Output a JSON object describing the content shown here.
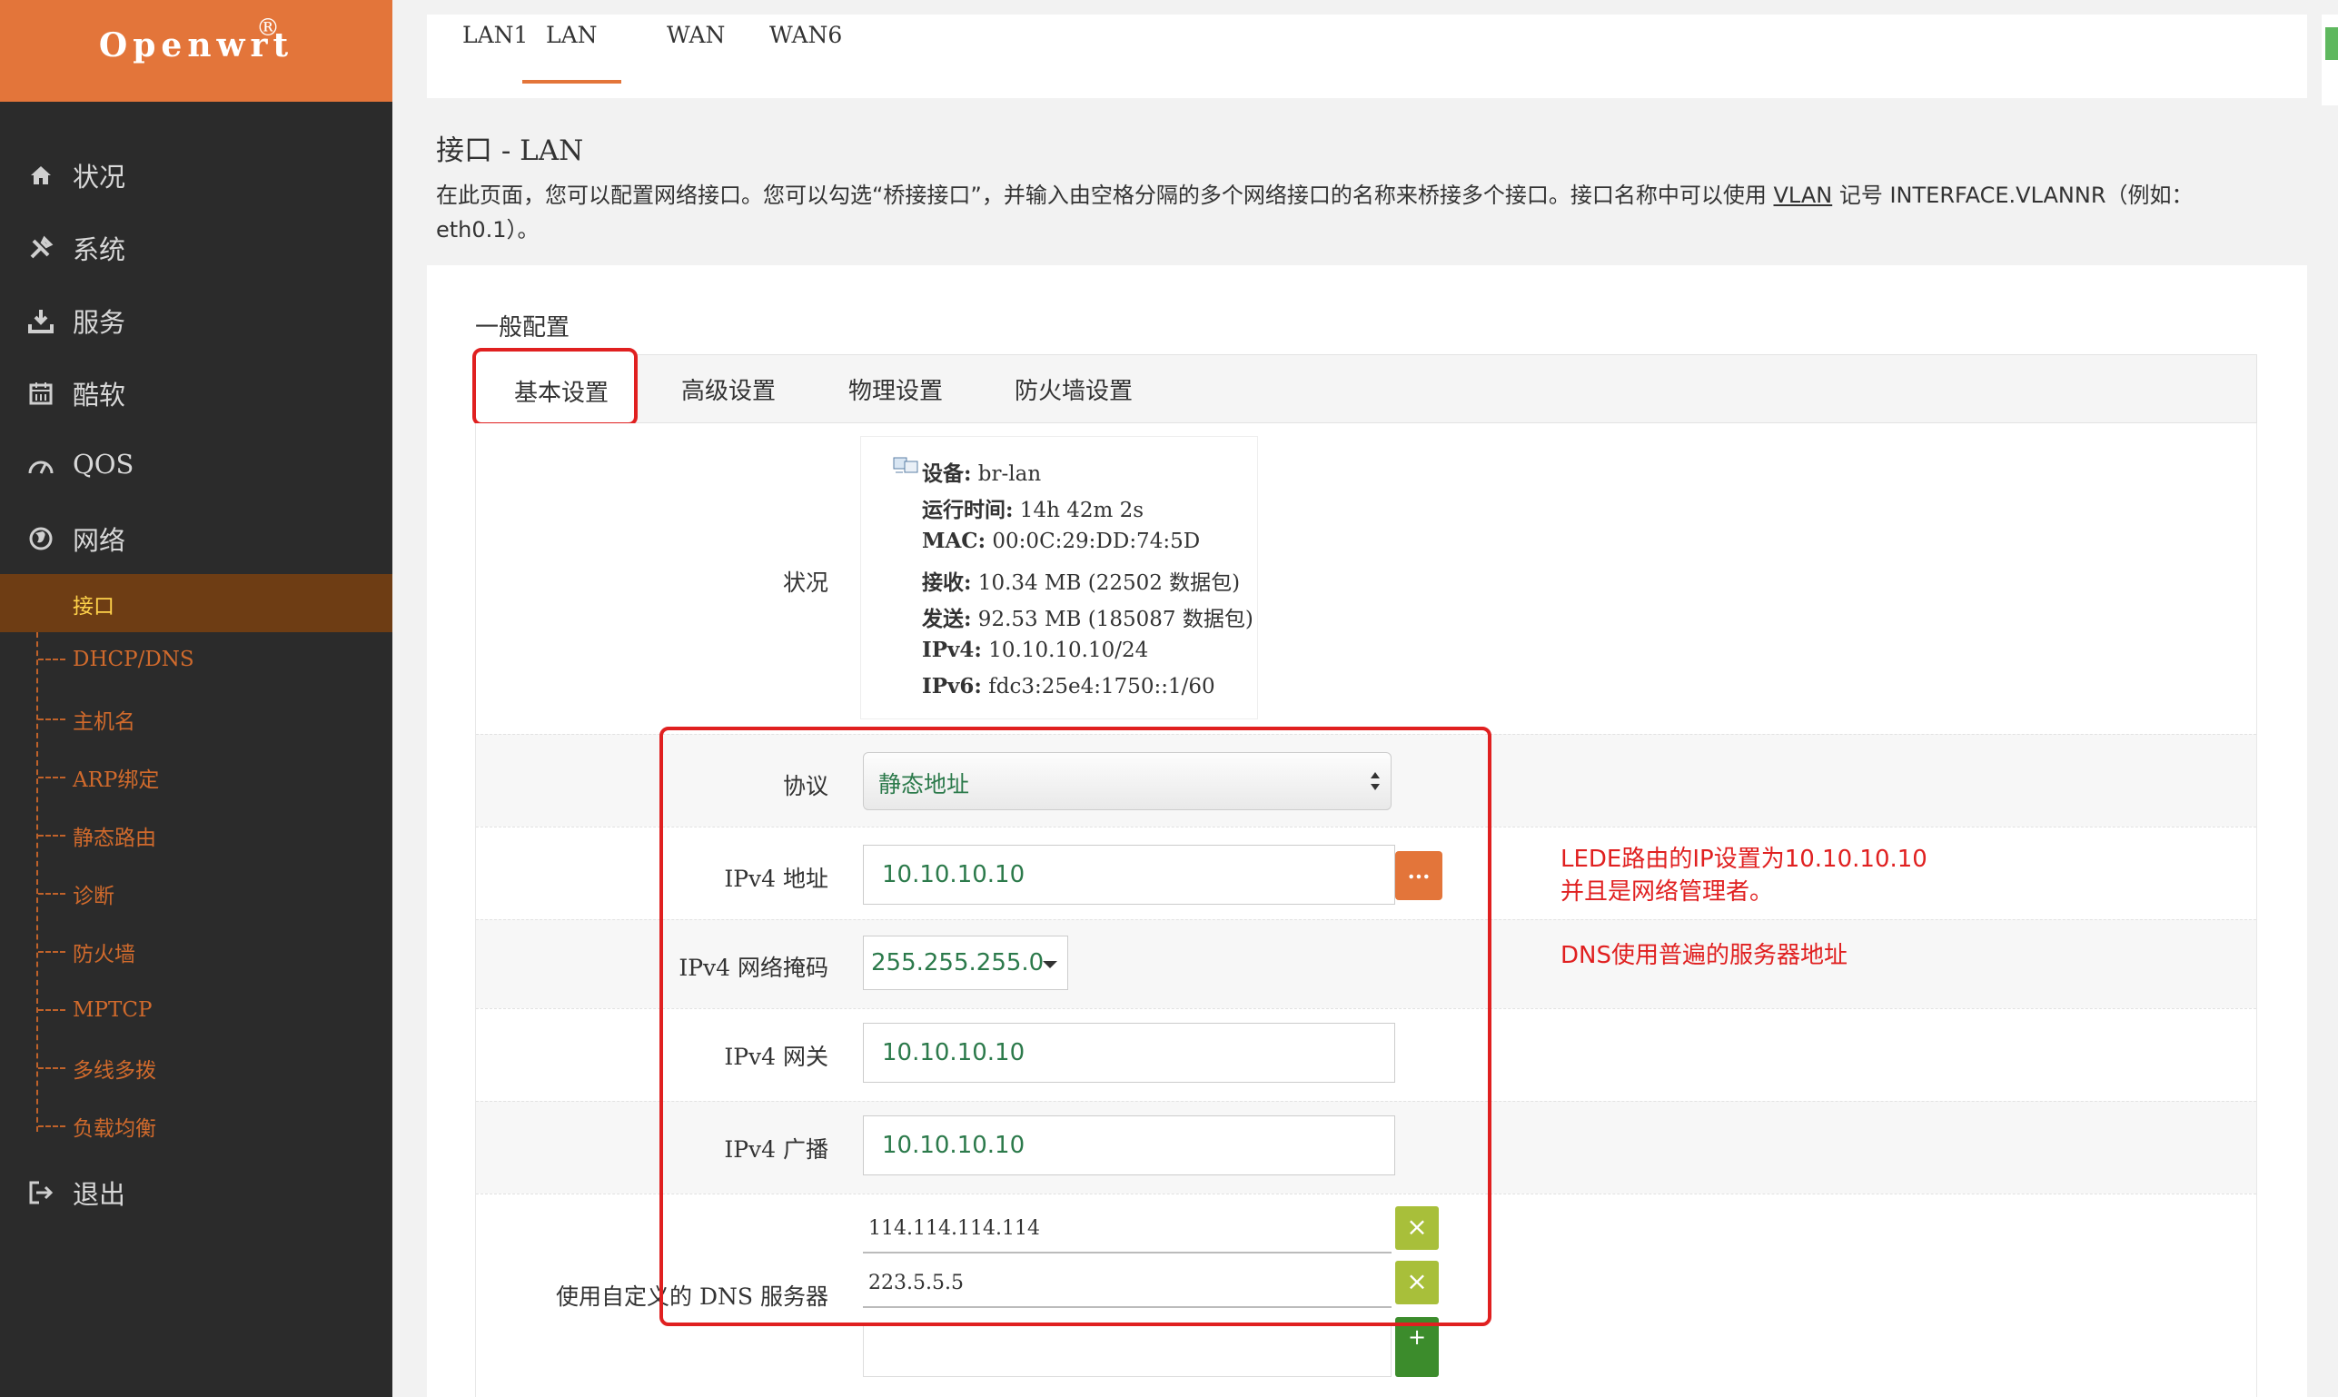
{
  "brand": {
    "name": "Openwrt",
    "reg": "®"
  },
  "sidebar": {
    "items": [
      {
        "label": "状况",
        "icon": "home-icon"
      },
      {
        "label": "系统",
        "icon": "tools-icon"
      },
      {
        "label": "服务",
        "icon": "download-icon"
      },
      {
        "label": "酷软",
        "icon": "calendar-icon"
      },
      {
        "label": "QOS",
        "icon": "gauge-icon"
      },
      {
        "label": "网络",
        "icon": "globe-icon"
      }
    ],
    "network_sub": [
      {
        "label": "接口",
        "active": true
      },
      {
        "label": "DHCP/DNS"
      },
      {
        "label": "主机名"
      },
      {
        "label": "ARP绑定"
      },
      {
        "label": "静态路由"
      },
      {
        "label": "诊断"
      },
      {
        "label": "防火墙"
      },
      {
        "label": "MPTCP"
      },
      {
        "label": "多线多拨"
      },
      {
        "label": "负载均衡"
      }
    ],
    "logout": {
      "label": "退出",
      "icon": "logout-icon"
    }
  },
  "top_tabs": [
    {
      "label": "LAN1"
    },
    {
      "label": "LAN",
      "active": true
    },
    {
      "label": "WAN"
    },
    {
      "label": "WAN6"
    }
  ],
  "page": {
    "title": "接口 - LAN",
    "desc_before": "在此页面，您可以配置网络接口。您可以勾选“桥接接口”，并输入由空格分隔的多个网络接口的名称来桥接多个接口。接口名称中可以使用 ",
    "desc_link": "VLAN",
    "desc_after": " 记号 INTERFACE.VLANNR（例如：eth0.1）。"
  },
  "section": {
    "title": "一般配置",
    "tabs": [
      "基本设置",
      "高级设置",
      "物理设置",
      "防火墙设置"
    ]
  },
  "status": {
    "label": "状况",
    "device_k": "设备:",
    "device_v": " br-lan",
    "uptime_k": "运行时间:",
    "uptime_v": " 14h 42m 2s",
    "mac_k": "MAC:",
    "mac_v": " 00:0C:29:DD:74:5D",
    "rx_k": "接收:",
    "rx_v": " 10.34 MB (22502 数据包)",
    "tx_k": "发送:",
    "tx_v": " 92.53 MB (185087 数据包)",
    "ipv4_k": "IPv4:",
    "ipv4_v": " 10.10.10.10/24",
    "ipv6_k": "IPv6:",
    "ipv6_v": " fdc3:25e4:1750::1/60"
  },
  "form": {
    "protocol": {
      "label": "协议",
      "value": "静态地址"
    },
    "ipv4_addr": {
      "label": "IPv4 地址",
      "value": "10.10.10.10",
      "btn": "..."
    },
    "ipv4_mask": {
      "label": "IPv4 网络掩码",
      "value": "255.255.255.0"
    },
    "ipv4_gw": {
      "label": "IPv4 网关",
      "value": "10.10.10.10"
    },
    "ipv4_bcast": {
      "label": "IPv4 广播",
      "value": "10.10.10.10"
    },
    "dns": {
      "label": "使用自定义的 DNS 服务器",
      "values": [
        "114.114.114.114",
        "223.5.5.5"
      ],
      "remove": "×",
      "add": "+"
    }
  },
  "annotations": {
    "line1": "LEDE路由的IP设置为10.10.10.10",
    "line2": "并且是网络管理者。",
    "line3": "DNS使用普遍的服务器地址"
  },
  "colors": {
    "accent": "#e3753a",
    "sidebar": "#2b2b2b",
    "annotation": "#e02020",
    "value_green": "#2c7a4b"
  }
}
